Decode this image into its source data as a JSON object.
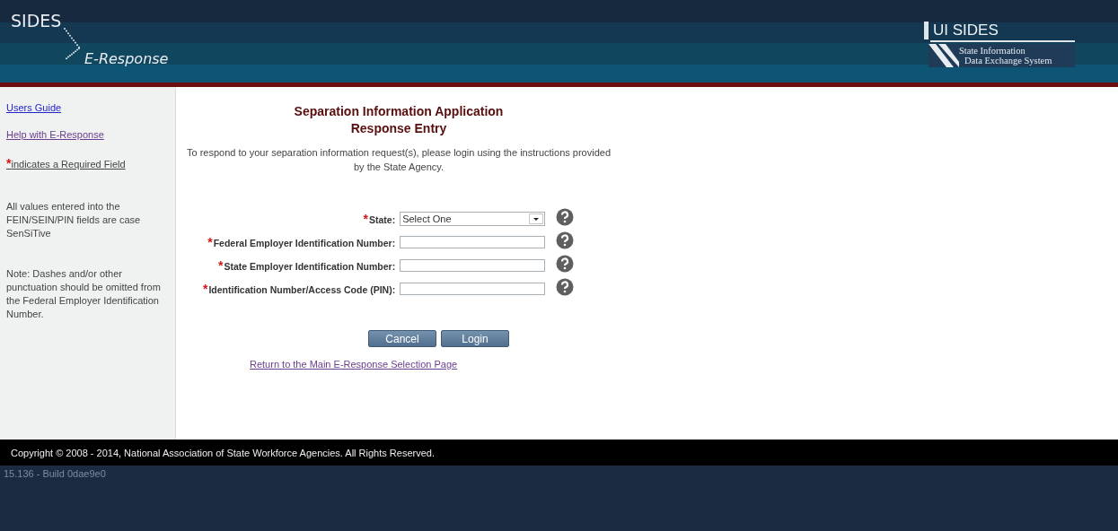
{
  "header": {
    "logo_left": {
      "top": "SIDES",
      "bottom": "E-Response"
    },
    "logo_right": {
      "title": "UI SIDES",
      "line_1": "State Information",
      "line_2": "Data Exchange System"
    }
  },
  "sidebar": {
    "links": [
      "Users Guide",
      "Help with E-Response"
    ],
    "required_note": {
      "mark": "*",
      "text": " indicates a Required Field"
    },
    "notes": [
      "All values entered into the FEIN/SEIN/PIN fields are case SenSiTive",
      "Note: Dashes and/or other punctuation should be omitted from the Federal Employer Identification Number."
    ]
  },
  "main": {
    "title": "Separation Information Application",
    "subtitle": "Response Entry",
    "intro": "To respond to your separation information request(s), please login using the instructions provided by the State Agency.",
    "required_mark": "*",
    "fields": [
      {
        "kind": "select",
        "label": "State:",
        "required": true,
        "value": "Select One"
      },
      {
        "kind": "text",
        "label": "Federal Employer Identification Number:",
        "required": true
      },
      {
        "kind": "text",
        "label": "State Employer Identification Number:",
        "required": true
      },
      {
        "kind": "text",
        "label": "Identification Number/Access Code (PIN):",
        "required": true
      }
    ],
    "buttons": [
      "Cancel",
      "Login"
    ],
    "return_link": "Return to the Main E-Response Selection Page"
  },
  "footer": {
    "copyright": "Copyright © 2008 - 2014, National Association of State Workforce Agencies. All Rights Reserved.",
    "version": "15.136 - Build 0dae9e0"
  }
}
